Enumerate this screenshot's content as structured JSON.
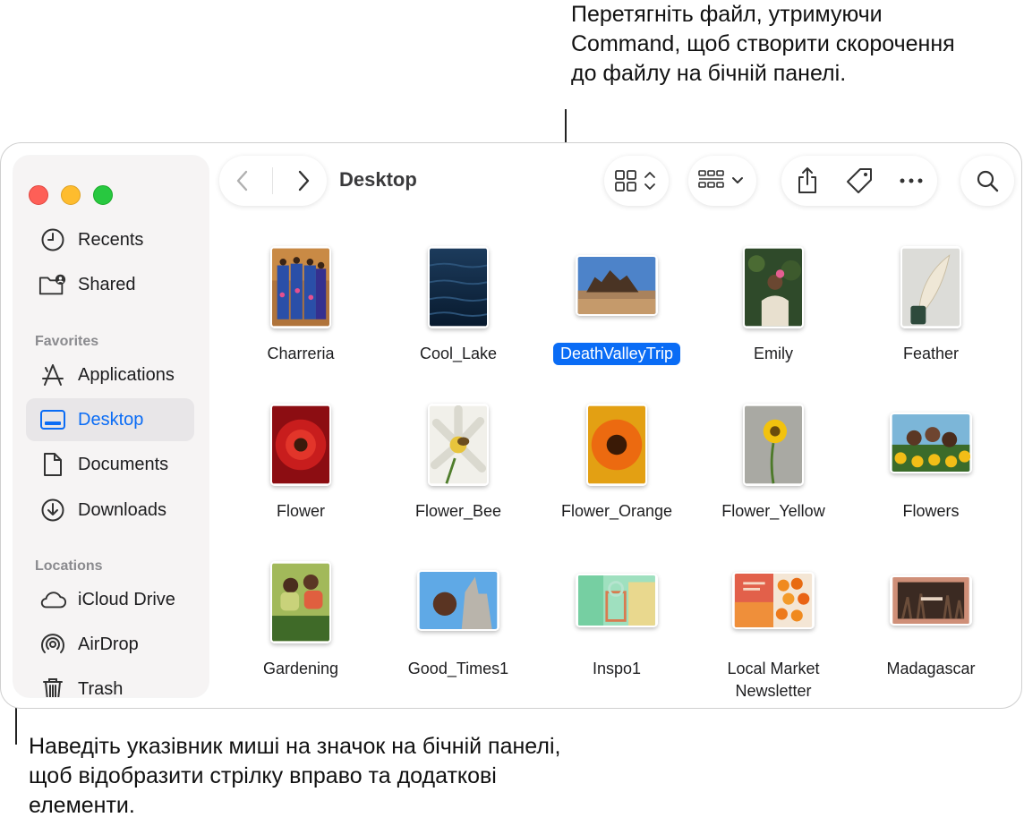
{
  "callouts": {
    "top": "Перетягніть файл, утримуючи Command, щоб створити скорочення до файлу на бічній панелі.",
    "bottom": "Наведіть указівник миші на значок на бічній панелі, щоб відобразити стрілку вправо та додаткові елементи."
  },
  "window": {
    "title": "Desktop"
  },
  "sidebar": {
    "top_items": [
      {
        "label": "Recents",
        "icon": "clock-icon"
      },
      {
        "label": "Shared",
        "icon": "shared-folder-icon"
      }
    ],
    "favorites_label": "Favorites",
    "favorites": [
      {
        "label": "Applications",
        "icon": "applications-icon"
      },
      {
        "label": "Desktop",
        "icon": "desktop-icon",
        "selected": true
      },
      {
        "label": "Documents",
        "icon": "document-icon"
      },
      {
        "label": "Downloads",
        "icon": "downloads-icon"
      }
    ],
    "locations_label": "Locations",
    "locations": [
      {
        "label": "iCloud Drive",
        "icon": "cloud-icon"
      },
      {
        "label": "AirDrop",
        "icon": "airdrop-icon"
      },
      {
        "label": "Trash",
        "icon": "trash-icon"
      }
    ]
  },
  "toolbar": {
    "icons": [
      "back-icon",
      "forward-icon",
      "grid-view-icon",
      "group-icon",
      "share-icon",
      "tag-icon",
      "more-icon",
      "search-icon"
    ]
  },
  "files": [
    {
      "name": "Charreria"
    },
    {
      "name": "Cool_Lake"
    },
    {
      "name": "DeathValleyTrip",
      "selected": true
    },
    {
      "name": "Emily"
    },
    {
      "name": "Feather"
    },
    {
      "name": "Flower"
    },
    {
      "name": "Flower_Bee"
    },
    {
      "name": "Flower_Orange"
    },
    {
      "name": "Flower_Yellow"
    },
    {
      "name": "Flowers"
    },
    {
      "name": "Gardening"
    },
    {
      "name": "Good_Times1"
    },
    {
      "name": "Inspo1"
    },
    {
      "name": "Local Market Newsletter"
    },
    {
      "name": "Madagascar"
    }
  ],
  "colors": {
    "accent": "#0a6cf5",
    "close": "#fe5f57",
    "minimize": "#febc2e",
    "zoom": "#28c840"
  }
}
